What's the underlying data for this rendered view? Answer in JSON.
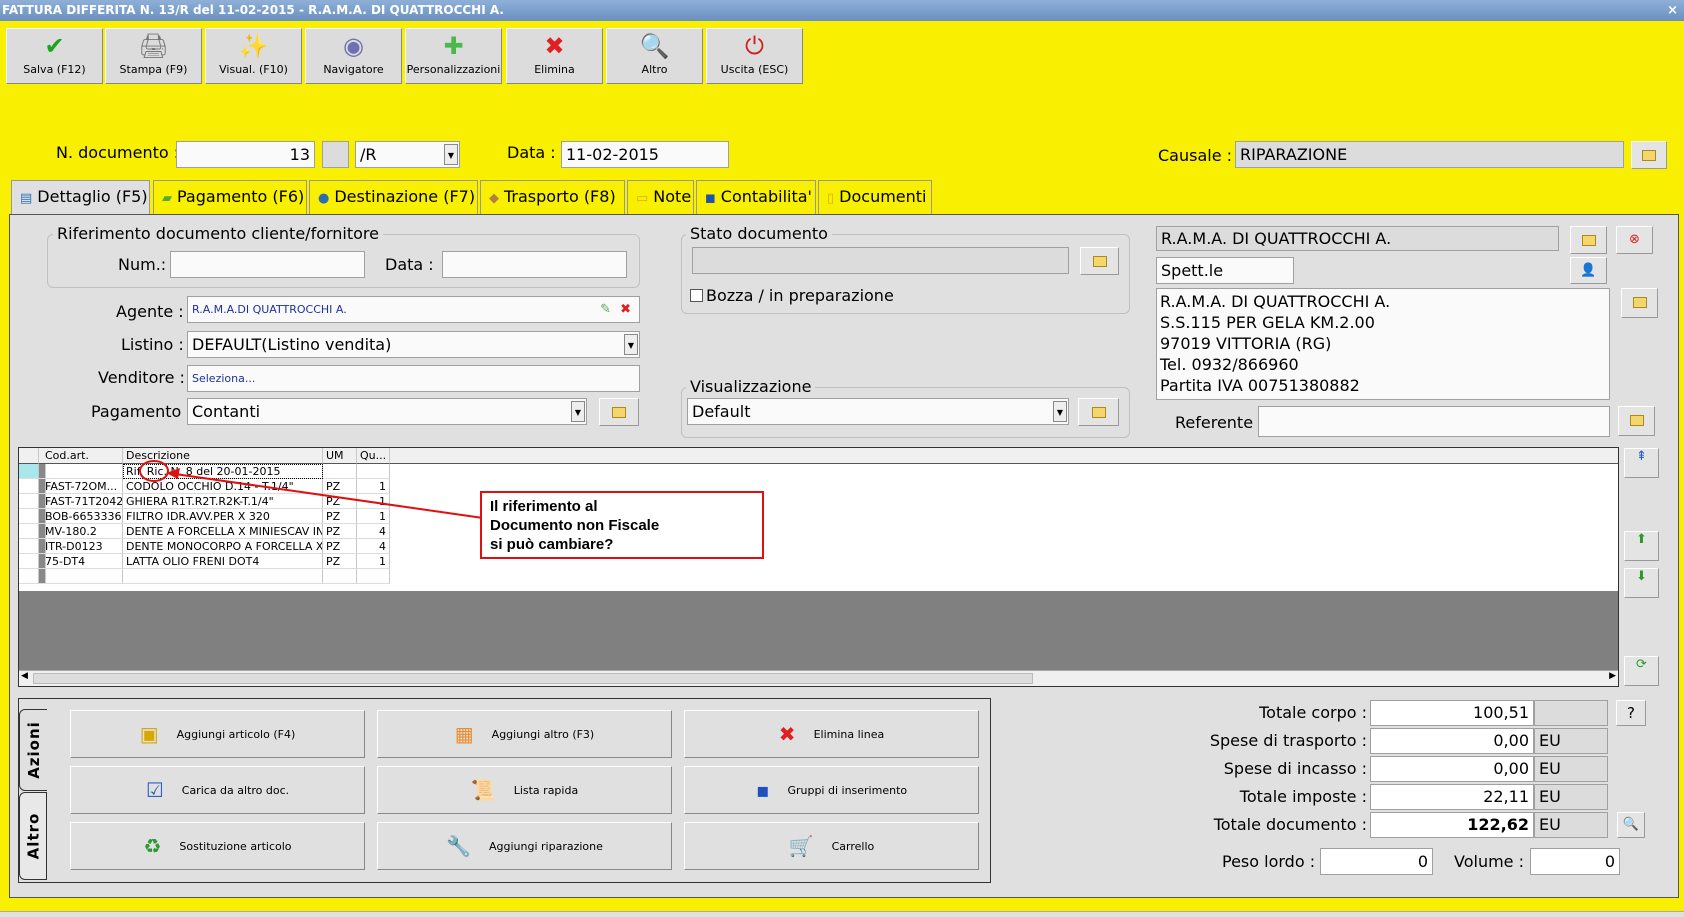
{
  "window": {
    "title": "FATTURA DIFFERITA N. 13/R del 11-02-2015 - R.A.M.A. DI QUATTROCCHI A.",
    "close": "×"
  },
  "toolbar": [
    {
      "label": "Salva (F12)",
      "icon": "check-icon",
      "glyph": "✔",
      "color": "#1aa51a"
    },
    {
      "label": "Stampa (F9)",
      "icon": "printer-icon",
      "glyph": "🖨",
      "color": "#777"
    },
    {
      "label": "Visual. (F10)",
      "icon": "magic-wand-icon",
      "glyph": "✨",
      "color": "#c9a000"
    },
    {
      "label": "Navigatore",
      "icon": "compass-icon",
      "glyph": "◉",
      "color": "#7070b0"
    },
    {
      "label": "Personalizzazioni",
      "icon": "puzzle-icon",
      "glyph": "✚",
      "color": "#4cb84c"
    },
    {
      "label": "Elimina",
      "icon": "delete-x-icon",
      "glyph": "✖",
      "color": "#e02020"
    },
    {
      "label": "Altro",
      "icon": "search-book-icon",
      "glyph": "🔍",
      "color": "#2060c0"
    },
    {
      "label": "Uscita (ESC)",
      "icon": "power-icon",
      "glyph": "⏻",
      "color": "#d02020"
    }
  ],
  "header": {
    "ndoc_label": "N. documento :",
    "ndoc_value": "13",
    "series": "/R",
    "data_label": "Data :",
    "data_value": "11-02-2015",
    "causale_label": "Causale :",
    "causale_value": "RIPARAZIONE"
  },
  "tabs": [
    "Dettaglio (F5)",
    "Pagamento (F6)",
    "Destinazione (F7)",
    "Trasporto (F8)",
    "Note",
    "Contabilita'",
    "Documenti"
  ],
  "rif": {
    "group": "Riferimento documento cliente/fornitore",
    "num_label": "Num.:",
    "num_value": "",
    "data_label": "Data :",
    "data_value": ""
  },
  "form": {
    "agente_label": "Agente :",
    "agente_value": "R.A.M.A.DI QUATTROCCHI A.",
    "listino_label": "Listino :",
    "listino_value": "DEFAULT(Listino vendita)",
    "venditore_label": "Venditore :",
    "venditore_placeholder": "Seleziona...",
    "pagamento_label": "Pagamento :",
    "pagamento_value": "Contanti"
  },
  "stato": {
    "group": "Stato documento",
    "value": "",
    "bozza_label": "Bozza / in preparazione",
    "bozza_checked": false
  },
  "visual": {
    "group": "Visualizzazione",
    "value": "Default"
  },
  "cliente": {
    "name": "R.A.M.A. DI QUATTROCCHI A.",
    "title": "Spett.le",
    "address": [
      "R.A.M.A. DI QUATTROCCHI A.",
      "S.S.115 PER GELA KM.2.00",
      "97019 VITTORIA (RG)",
      "Tel. 0932/866960",
      "Partita IVA 00751380882"
    ],
    "referente_label": "Referente",
    "referente_value": ""
  },
  "grid": {
    "columns": [
      "Cod.art.",
      "Descrizione",
      "UM",
      "Qu..."
    ],
    "rows": [
      [
        "",
        "Rif. Ric. N. 8 del 20-01-2015",
        "",
        ""
      ],
      [
        "FAST-72OM...",
        "CODOLO OCCHIO D.14 - T.1/4\"",
        "PZ",
        "1"
      ],
      [
        "FAST-71T2042",
        "GHIERA R1T.R2T.R2K-T.1/4\"",
        "PZ",
        "1"
      ],
      [
        "BOB-6653336",
        "FILTRO IDR.AVV.PER X 320",
        "PZ",
        "1"
      ],
      [
        "MV-180.2",
        "DENTE A FORCELLA  X MINIESCAV IN...",
        "PZ",
        "4"
      ],
      [
        "ITR-D0123",
        "DENTE MONOCORPO A FORCELLA X ...",
        "PZ",
        "4"
      ],
      [
        "75-DT4",
        "LATTA OLIO FRENI DOT4",
        "PZ",
        "1"
      ]
    ]
  },
  "callout": {
    "lines": [
      "Il riferimento al",
      "Documento non Fiscale",
      "si può cambiare?"
    ],
    "color": "#e01010"
  },
  "actions": {
    "tabs": [
      "Azioni",
      "Altro"
    ],
    "buttons": [
      {
        "label": "Aggiungi articolo (F4)",
        "glyph": "▣",
        "color": "#d8a800"
      },
      {
        "label": "Aggiungi altro (F3)",
        "glyph": "▦",
        "color": "#e89030"
      },
      {
        "label": "Elimina linea",
        "glyph": "✖",
        "color": "#e02020"
      },
      {
        "label": "Carica da altro doc.",
        "glyph": "☑",
        "color": "#3060c0"
      },
      {
        "label": "Lista rapida",
        "glyph": "📜",
        "color": "#888"
      },
      {
        "label": "Gruppi di inserimento",
        "glyph": "▪",
        "color": "#2050c0"
      },
      {
        "label": "Sostituzione articolo",
        "glyph": "♻",
        "color": "#2a9a2a"
      },
      {
        "label": "Aggiungi riparazione",
        "glyph": "🔧",
        "color": "#888"
      },
      {
        "label": "Carrello",
        "glyph": "🛒",
        "color": "#888"
      }
    ]
  },
  "totals": {
    "rows": [
      {
        "label": "Totale corpo :",
        "value": "100,51",
        "unit": ""
      },
      {
        "label": "Spese di trasporto :",
        "value": "0,00",
        "unit": "EU"
      },
      {
        "label": "Spese di incasso :",
        "value": "0,00",
        "unit": "EU"
      },
      {
        "label": "Totale imposte :",
        "value": "22,11",
        "unit": "EU"
      },
      {
        "label": "Totale documento :",
        "value": "122,62",
        "unit": "EU"
      }
    ],
    "help": "?",
    "peso_label": "Peso lordo :",
    "peso_value": "0",
    "volume_label": "Volume :",
    "volume_value": "0"
  }
}
